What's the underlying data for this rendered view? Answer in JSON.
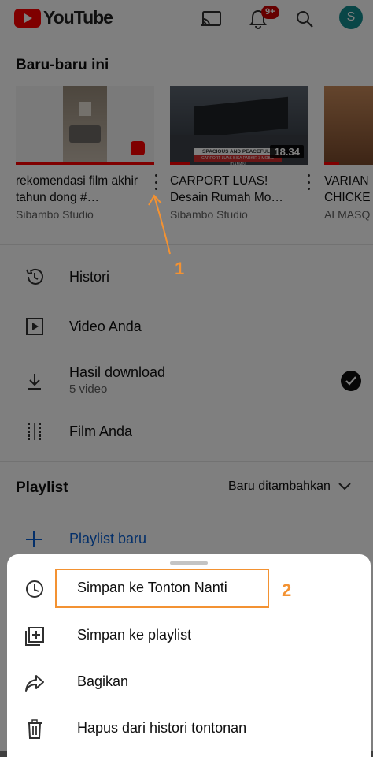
{
  "app": {
    "brand": "YouTube",
    "notification_count": "9+",
    "avatar_letter": "S"
  },
  "recent": {
    "title": "Baru-baru ini",
    "videos": [
      {
        "title": "rekomendasi film akhir tahun dong #…",
        "channel": "Sibambo Studio",
        "duration": "",
        "progress": 1.0
      },
      {
        "title": "CARPORT LUAS! Desain Rumah Mo…",
        "channel": "Sibambo Studio",
        "duration": "18.34",
        "progress": 0.15,
        "thumb_text_1": "SPACIOUS AND PEACEFUL",
        "thumb_text_2": "CARPORT LUAS BISA PARKIR 3 MOBIL IDAMAN"
      },
      {
        "title": "VARIAN CHICKE",
        "channel": "ALMASQ",
        "duration": "",
        "progress": 0.3
      }
    ]
  },
  "library": [
    {
      "label": "Histori",
      "sublabel": "",
      "icon": "history-icon"
    },
    {
      "label": "Video Anda",
      "sublabel": "",
      "icon": "play-square-icon"
    },
    {
      "label": "Hasil download",
      "sublabel": "5 video",
      "icon": "download-icon"
    },
    {
      "label": "Film Anda",
      "sublabel": "",
      "icon": "film-icon"
    }
  ],
  "playlist": {
    "title": "Playlist",
    "sort_label": "Baru ditambahkan",
    "new_label": "Playlist baru"
  },
  "sheet": {
    "items": [
      {
        "label": "Simpan ke Tonton Nanti",
        "icon": "clock-icon"
      },
      {
        "label": "Simpan ke playlist",
        "icon": "playlist-add-icon"
      },
      {
        "label": "Bagikan",
        "icon": "share-icon"
      },
      {
        "label": "Hapus dari histori tontonan",
        "icon": "trash-icon"
      }
    ]
  },
  "annotations": {
    "step1": "1",
    "step2": "2"
  },
  "colors": {
    "brand_red": "#ff0000",
    "annotation_orange": "#f39232",
    "link_blue": "#065fd4",
    "avatar_teal": "#128c8e"
  }
}
